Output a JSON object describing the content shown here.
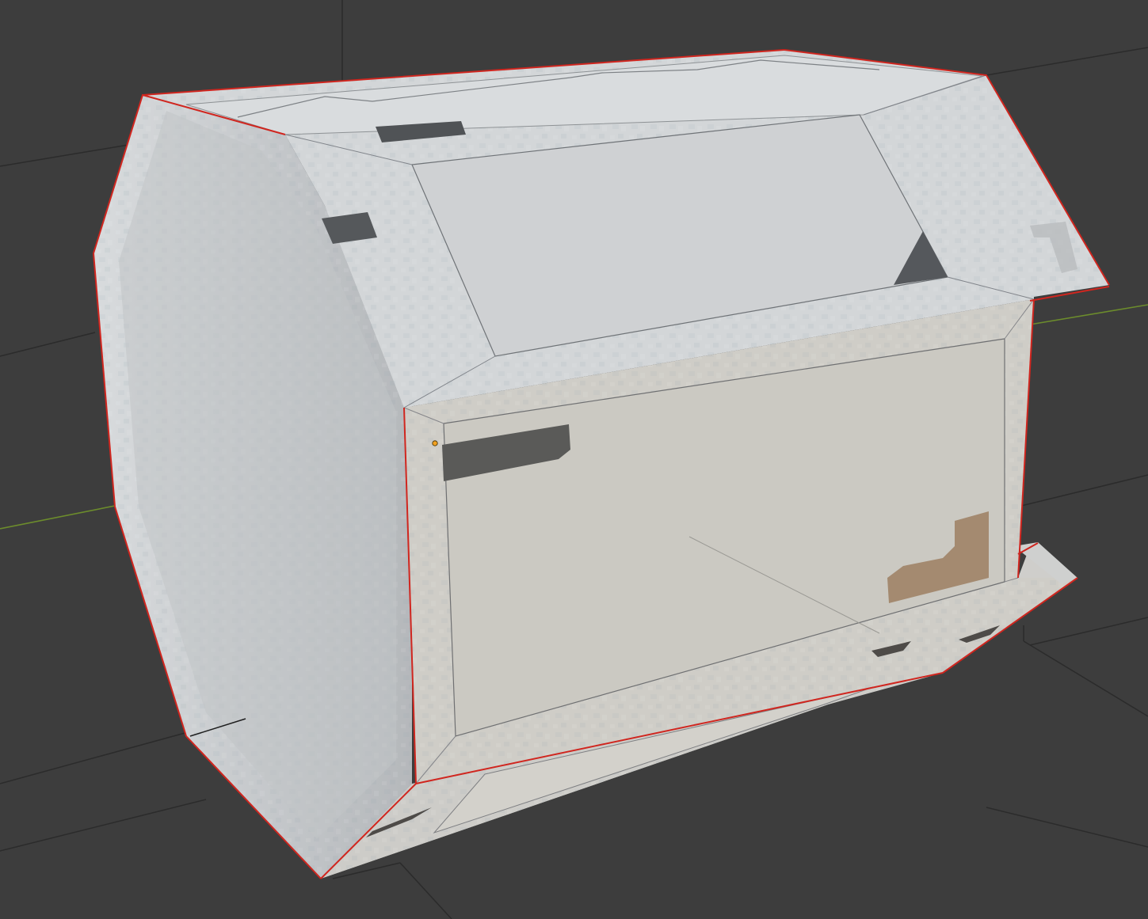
{
  "viewport": {
    "background_color": "#3d3d3d",
    "grid_color": "#2a2a2a",
    "x_axis_color": "#6a8a2a",
    "y_axis_color": "#8ab040",
    "selection_outline_color": "#d02a20",
    "active_vertex_color": "#f0a020"
  },
  "object": {
    "mode": "edit",
    "shading": "textured",
    "face_colors": {
      "top": "#d6dadc",
      "top_inner": "#c8cbcd",
      "side": "#c9ccce",
      "front_frame": "#d0cfca",
      "front_inner": "#cbc9c2",
      "bottom": "#cfcecb",
      "dark_panel": "#4a4c4f",
      "decal_brown": "#a08870"
    }
  }
}
